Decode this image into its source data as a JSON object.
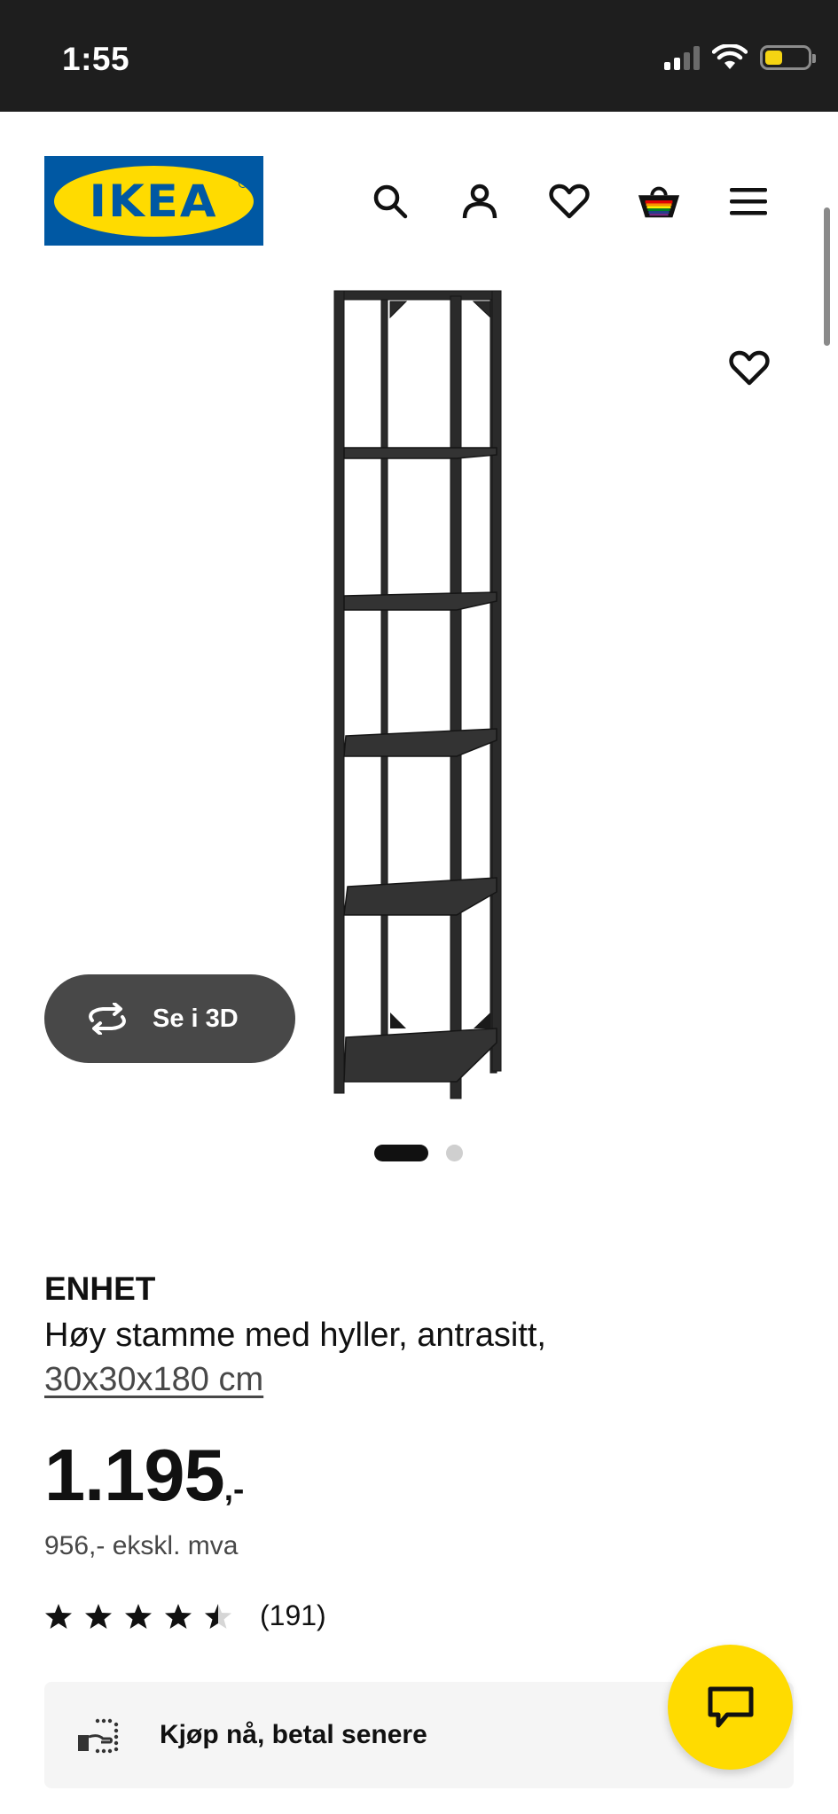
{
  "status_bar": {
    "time": "1:55"
  },
  "header": {
    "logo_text": "IKEA",
    "icons": [
      "search-icon",
      "account-icon",
      "heart-icon",
      "basket-icon",
      "menu-icon"
    ]
  },
  "product": {
    "name": "ENHET",
    "description": "Høy stamme med hyller, antrasitt,",
    "size": "30x30x180 cm",
    "price_main": "1.195",
    "price_suffix": ",-",
    "price_ex_vat": "956,- ekskl. mva",
    "rating_stars": 4.5,
    "rating_count": "(191)",
    "view_3d_label": "Se i 3D",
    "image_count": 2,
    "active_image": 1
  },
  "bnpl": {
    "label": "Kjøp nå, betal senere"
  },
  "colors": {
    "brand_blue": "#0058a3",
    "brand_yellow": "#ffdb00",
    "text": "#111111",
    "muted": "#484848"
  }
}
